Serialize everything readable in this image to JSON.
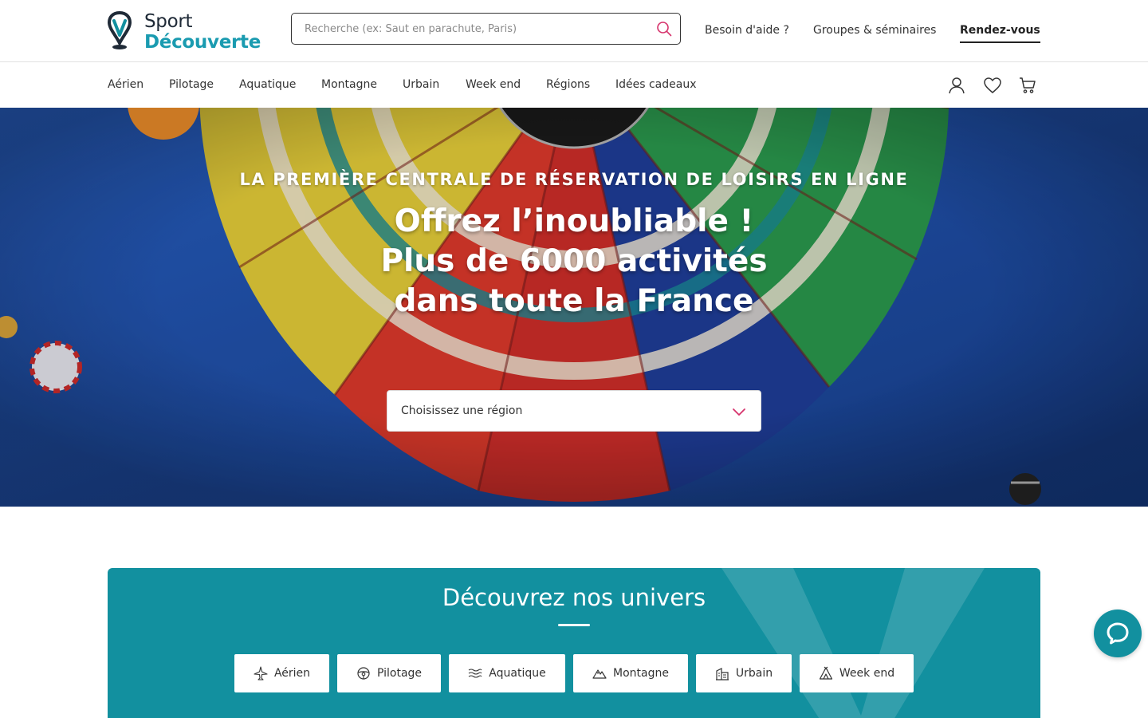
{
  "brand": {
    "name_line1": "Sport",
    "name_line2": "Découverte",
    "primary_color": "#12909f",
    "accent_color": "#d6336c"
  },
  "search": {
    "placeholder": "Recherche (ex: Saut en parachute, Paris)",
    "value": "",
    "icon": "search-icon"
  },
  "top_links": [
    {
      "label": "Besoin d'aide ?"
    },
    {
      "label": "Groupes & séminaires"
    },
    {
      "label": "Rendez-vous"
    }
  ],
  "nav": {
    "items": [
      {
        "label": "Aérien"
      },
      {
        "label": "Pilotage"
      },
      {
        "label": "Aquatique"
      },
      {
        "label": "Montagne"
      },
      {
        "label": "Urbain"
      },
      {
        "label": "Week end"
      },
      {
        "label": "Régions"
      },
      {
        "label": "Idées cadeaux"
      }
    ],
    "icons": [
      "user-icon",
      "heart-icon",
      "cart-icon"
    ]
  },
  "hero": {
    "kicker": "LA PREMIÈRE CENTRALE DE RÉSERVATION DE LOISIRS EN LIGNE",
    "title": "Offrez l’inoubliable ! Plus de 6000 activités dans toute la France",
    "region_select": {
      "placeholder": "Choisissez une région",
      "icon": "chevron-down-icon"
    }
  },
  "universe": {
    "title": "Découvrez nos univers",
    "buttons": [
      {
        "label": "Aérien",
        "icon": "plane-icon"
      },
      {
        "label": "Pilotage",
        "icon": "steering-wheel-icon"
      },
      {
        "label": "Aquatique",
        "icon": "waves-icon"
      },
      {
        "label": "Montagne",
        "icon": "mountain-icon"
      },
      {
        "label": "Urbain",
        "icon": "building-icon"
      },
      {
        "label": "Week end",
        "icon": "tent-icon"
      }
    ]
  },
  "chat": {
    "icon": "chat-icon"
  }
}
